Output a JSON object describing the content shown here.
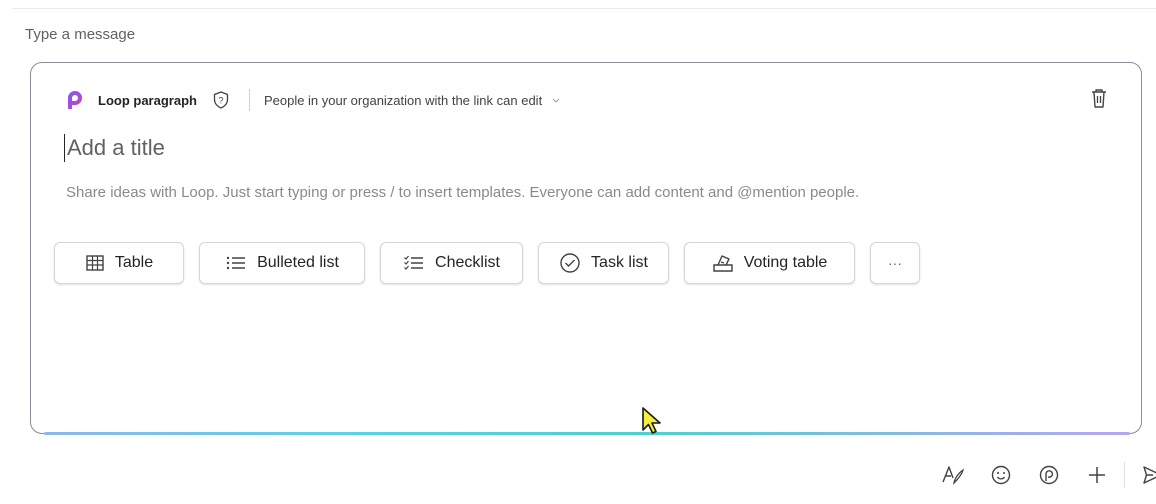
{
  "composer": {
    "placeholder": "Type a message"
  },
  "loop": {
    "title": "Loop paragraph",
    "permission": "People in your organization with the link can edit",
    "title_placeholder": "Add a title",
    "hint": "Share ideas with Loop. Just start typing or press / to insert templates. Everyone can add content and @mention people.",
    "accent": "#b146c2",
    "chips": [
      {
        "label": "Table",
        "icon": "table-icon"
      },
      {
        "label": "Bulleted list",
        "icon": "bulleted-list-icon"
      },
      {
        "label": "Checklist",
        "icon": "checklist-icon"
      },
      {
        "label": "Task list",
        "icon": "task-list-icon"
      },
      {
        "label": "Voting table",
        "icon": "voting-table-icon"
      },
      {
        "label": "···",
        "icon": "more-icon"
      }
    ]
  },
  "toolbar": {
    "icons": [
      "format-icon",
      "emoji-icon",
      "loop-icon",
      "add-icon",
      "send-icon"
    ]
  }
}
